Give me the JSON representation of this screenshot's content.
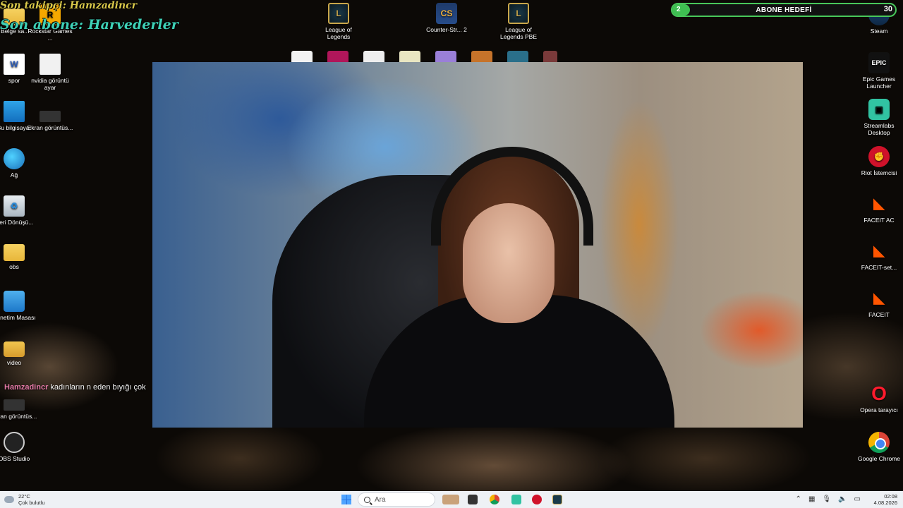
{
  "overlay": {
    "last_follower": "Son takipçi: Hamzadincr",
    "last_subscriber": "Son abone: Harvederler"
  },
  "goal": {
    "current": "2",
    "title": "ABONE HEDEFİ",
    "target": "30",
    "progress": 0.0667,
    "color": "#3fbf52"
  },
  "desktop": {
    "left_icons": [
      {
        "label": "Belge sa..",
        "icon": "folder-icon"
      },
      {
        "label": "spor",
        "icon": "word-doc-icon"
      },
      {
        "label": "Bu bilgisayar",
        "icon": "monitor-icon"
      },
      {
        "label": "Ağ",
        "icon": "network-icon"
      },
      {
        "label": "Geri Dönüşü...",
        "icon": "recycle-bin-icon"
      },
      {
        "label": "obs",
        "icon": "folder-icon"
      },
      {
        "label": "Denetim Masası",
        "icon": "control-panel-icon"
      },
      {
        "label": "video",
        "icon": "video-folder-icon"
      },
      {
        "label": "Ekran görüntüs...",
        "icon": "screenshot-icon"
      },
      {
        "label": "OBS Studio",
        "icon": "obs-icon"
      }
    ],
    "second_column": [
      {
        "label": "Rockstar Games ...",
        "icon": "rockstar-icon"
      },
      {
        "label": "nvidia görüntü ayar",
        "icon": "document-icon"
      },
      {
        "label": "Ekran görüntüs...",
        "icon": "screenshot-icon"
      }
    ],
    "top_icons": [
      {
        "label": "League of Legends",
        "icon": "league-icon"
      },
      {
        "label": "Counter-Str... 2",
        "icon": "counter-strike-icon"
      },
      {
        "label": "League of Legends PBE",
        "icon": "league-icon"
      }
    ],
    "right_icons": [
      {
        "label": "Steam",
        "icon": "steam-icon"
      },
      {
        "label": "Epic Games Launcher",
        "icon": "epic-games-icon"
      },
      {
        "label": "Streamlabs Desktop",
        "icon": "streamlabs-icon"
      },
      {
        "label": "Riot İstemcisi",
        "icon": "riot-icon"
      },
      {
        "label": "FACEIT AC",
        "icon": "faceit-ac-icon"
      },
      {
        "label": "FACEIT-set...",
        "icon": "faceit-icon"
      },
      {
        "label": "FACEIT",
        "icon": "faceit-icon"
      },
      {
        "label": "Opera tarayıcı",
        "icon": "opera-icon"
      },
      {
        "label": "Google Chrome",
        "icon": "chrome-icon"
      }
    ]
  },
  "chat": {
    "user": "Hamzadincr",
    "message": "kadınların n eden bıyığı çok"
  },
  "taskbar": {
    "weather_temp": "22°C",
    "weather_desc": "Çok bulutlu",
    "search_placeholder": "Ara",
    "time": "02:08",
    "date": "4.08.2026"
  }
}
